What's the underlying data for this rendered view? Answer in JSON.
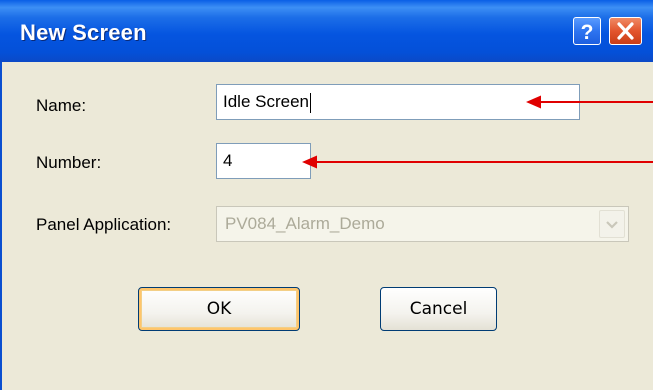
{
  "dialog": {
    "title": "New Screen",
    "help_icon": "question-mark-icon",
    "close_icon": "close-x-icon"
  },
  "form": {
    "name_label": "Name:",
    "name_value": "Idle Screen",
    "number_label": "Number:",
    "number_value": "4",
    "panel_app_label": "Panel Application:",
    "panel_app_value": "PV084_Alarm_Demo",
    "panel_app_enabled": false
  },
  "buttons": {
    "ok_label": "OK",
    "cancel_label": "Cancel"
  },
  "annotations": {
    "arrow_color": "#e00000"
  }
}
